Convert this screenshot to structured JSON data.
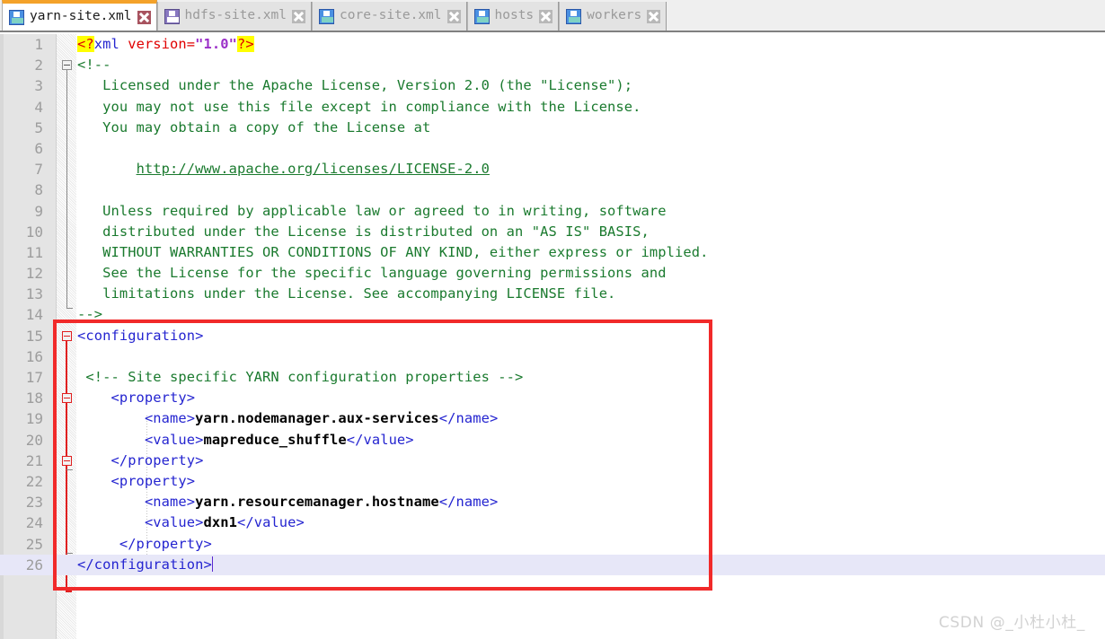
{
  "tabs": [
    {
      "label": "yarn-site.xml",
      "icon": "floppy-save-icon",
      "close_icon": "close-icon",
      "active": true,
      "icon_color": "#4a90e2",
      "close_color": "#a8535f"
    },
    {
      "label": "hdfs-site.xml",
      "icon": "floppy-save-icon",
      "close_icon": "close-icon",
      "active": false,
      "icon_color": "#8878c0",
      "close_color": "#b8b8b8"
    },
    {
      "label": "core-site.xml",
      "icon": "floppy-save-icon",
      "close_icon": "close-icon",
      "active": false,
      "icon_color": "#4a90e2",
      "close_color": "#b8b8b8"
    },
    {
      "label": "hosts",
      "icon": "floppy-save-icon",
      "close_icon": "close-icon",
      "active": false,
      "icon_color": "#4a90e2",
      "close_color": "#b8b8b8"
    },
    {
      "label": "workers",
      "icon": "floppy-save-icon",
      "close_icon": "close-icon",
      "active": false,
      "icon_color": "#4a90e2",
      "close_color": "#b8b8b8"
    }
  ],
  "editor": {
    "line_numbers": [
      "1",
      "2",
      "3",
      "4",
      "5",
      "6",
      "7",
      "8",
      "9",
      "10",
      "11",
      "12",
      "13",
      "14",
      "15",
      "16",
      "17",
      "18",
      "19",
      "20",
      "21",
      "22",
      "23",
      "24",
      "25",
      "26"
    ],
    "current_line": "26",
    "lines": {
      "l1_pi_open": "<?",
      "l1_pi_name": "xml",
      "l1_attr": " version=",
      "l1_attrval": "\"1.0\"",
      "l1_pi_close": "?>",
      "l2": "<!--",
      "l3": "   Licensed under the Apache License, Version 2.0 (the \"License\");",
      "l4": "   you may not use this file except in compliance with the License.",
      "l5": "   You may obtain a copy of the License at",
      "l6": "",
      "l7_indent": "       ",
      "l7_link": "http://www.apache.org/licenses/LICENSE-2.0",
      "l8": "",
      "l9": "   Unless required by applicable law or agreed to in writing, software",
      "l10": "   distributed under the License is distributed on an \"AS IS\" BASIS,",
      "l11": "   WITHOUT WARRANTIES OR CONDITIONS OF ANY KIND, either express or implied.",
      "l12": "   See the License for the specific language governing permissions and",
      "l13": "   limitations under the License. See accompanying LICENSE file.",
      "l14": "-->",
      "l15": "<configuration>",
      "l16": "",
      "l17": " <!-- Site specific YARN configuration properties -->",
      "l18": "    <property>",
      "l19_indent": "        ",
      "l19_open": "<name>",
      "l19_text": "yarn.nodemanager.aux-services",
      "l19_close": "</name>",
      "l20_indent": "        ",
      "l20_open": "<value>",
      "l20_text": "mapreduce_shuffle",
      "l20_close": "</value>",
      "l21": "    </property>",
      "l22": "    <property>",
      "l23_indent": "        ",
      "l23_open": "<name>",
      "l23_text": "yarn.resourcemanager.hostname",
      "l23_close": "</name>",
      "l24_indent": "        ",
      "l24_open": "<value>",
      "l24_text": "dxn1",
      "l24_close": "</value>",
      "l25": "     </property>",
      "l26": "</configuration>"
    }
  },
  "annotation": {
    "shape": "rectangle",
    "color": "#f12a2a",
    "covers_lines": "15-26"
  },
  "watermark": {
    "text": "CSDN @_小杜小杜_"
  },
  "colors": {
    "tab_active_accent": "#f4a22a",
    "tag": "#2424d0",
    "comment": "#1a7a2e",
    "attribute": "#e00000",
    "attribute_value": "#9b30c8",
    "pi_highlight": "#ffff00",
    "current_line": "#e7e7f8",
    "gutter_bg": "#e4e4e4",
    "annotation": "#f12a2a"
  }
}
